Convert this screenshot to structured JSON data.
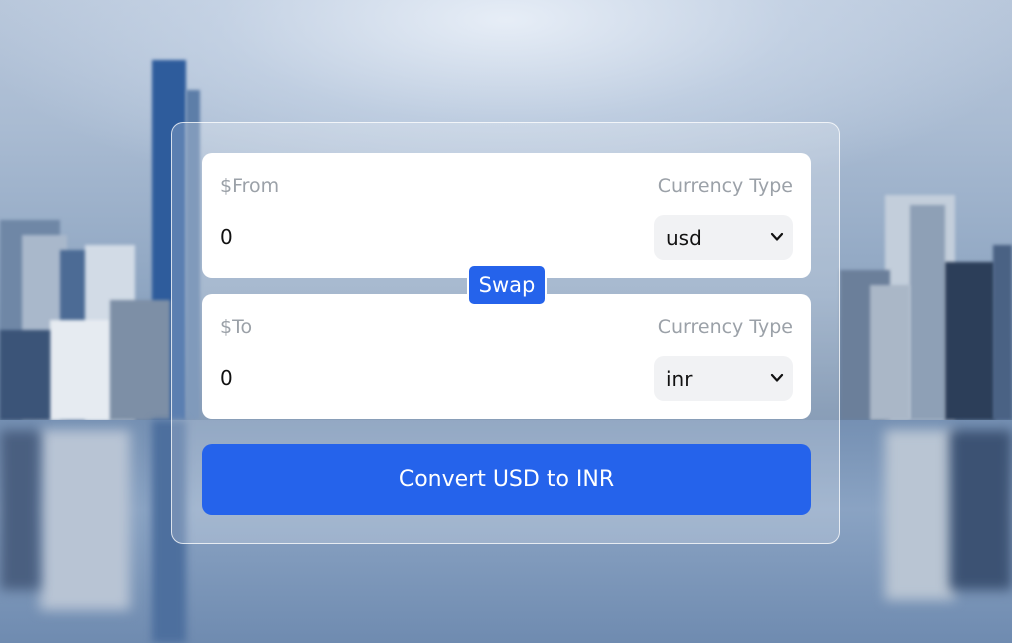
{
  "from": {
    "label": "$From",
    "currency_type_label": "Currency Type",
    "amount": "0",
    "currency": "usd"
  },
  "swap_label": "Swap",
  "to": {
    "label": "$To",
    "currency_type_label": "Currency Type",
    "amount": "0",
    "currency": "inr"
  },
  "convert_label": "Convert USD to INR",
  "colors": {
    "accent": "#2563eb",
    "card_bg": "#ffffff",
    "muted_text": "#9ba1a8",
    "select_bg": "#f1f2f4"
  },
  "icons": {
    "select_arrow": "chevron-down-icon"
  }
}
